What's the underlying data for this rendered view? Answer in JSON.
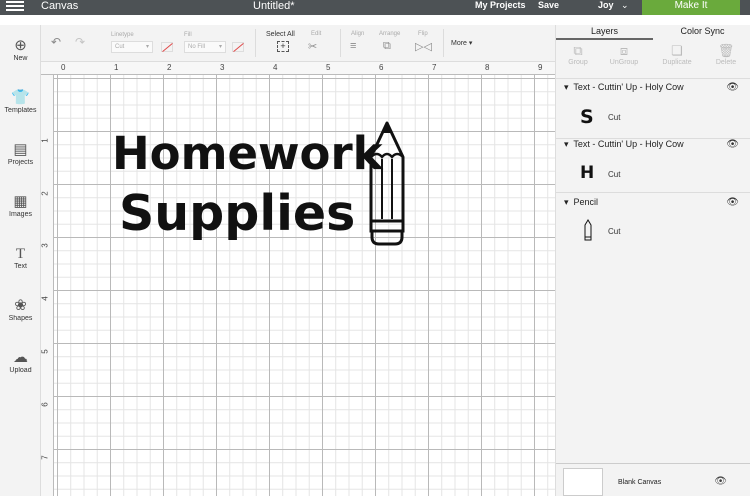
{
  "topbar": {
    "app_name": "Canvas",
    "document_title": "Untitled*",
    "my_projects": "My Projects",
    "save": "Save",
    "user": "Joy",
    "make_it": "Make It"
  },
  "toolbar": {
    "linetype_label": "Linetype",
    "linetype_value": "Cut",
    "fill_label": "Fill",
    "fill_value": "No Fill",
    "select_all": "Select All",
    "edit": "Edit",
    "align": "Align",
    "arrange": "Arrange",
    "flip": "Flip",
    "more": "More"
  },
  "sidebar": {
    "items": [
      {
        "label": "New",
        "icon": "plus-circle-icon"
      },
      {
        "label": "Templates",
        "icon": "shirt-icon"
      },
      {
        "label": "Projects",
        "icon": "projects-icon"
      },
      {
        "label": "Images",
        "icon": "image-icon"
      },
      {
        "label": "Text",
        "icon": "text-icon"
      },
      {
        "label": "Shapes",
        "icon": "shapes-icon"
      },
      {
        "label": "Upload",
        "icon": "upload-icon"
      }
    ]
  },
  "rulers": {
    "horizontal": [
      "0",
      "1",
      "2",
      "3",
      "4",
      "5",
      "6",
      "7",
      "8",
      "9"
    ],
    "vertical": [
      "1",
      "2",
      "3",
      "4",
      "5",
      "6",
      "7"
    ]
  },
  "canvas": {
    "line1": "Homework",
    "line2": "Supplies"
  },
  "panel": {
    "tab_layers": "Layers",
    "tab_color_sync": "Color Sync",
    "tools": [
      "Group",
      "UnGroup",
      "Duplicate",
      "Delete"
    ],
    "layers": [
      {
        "name": "Text - Cuttin' Up - Holy Cow",
        "thumb": "S",
        "operation": "Cut"
      },
      {
        "name": "Text - Cuttin' Up - Holy Cow",
        "thumb": "H",
        "operation": "Cut"
      },
      {
        "name": "Pencil",
        "thumb": "",
        "operation": "Cut"
      }
    ],
    "blank_canvas": "Blank Canvas"
  },
  "colors": {
    "topbar": "#4d5255",
    "make_it": "#6aaa3c",
    "panel_bg": "#f3f3f3"
  }
}
